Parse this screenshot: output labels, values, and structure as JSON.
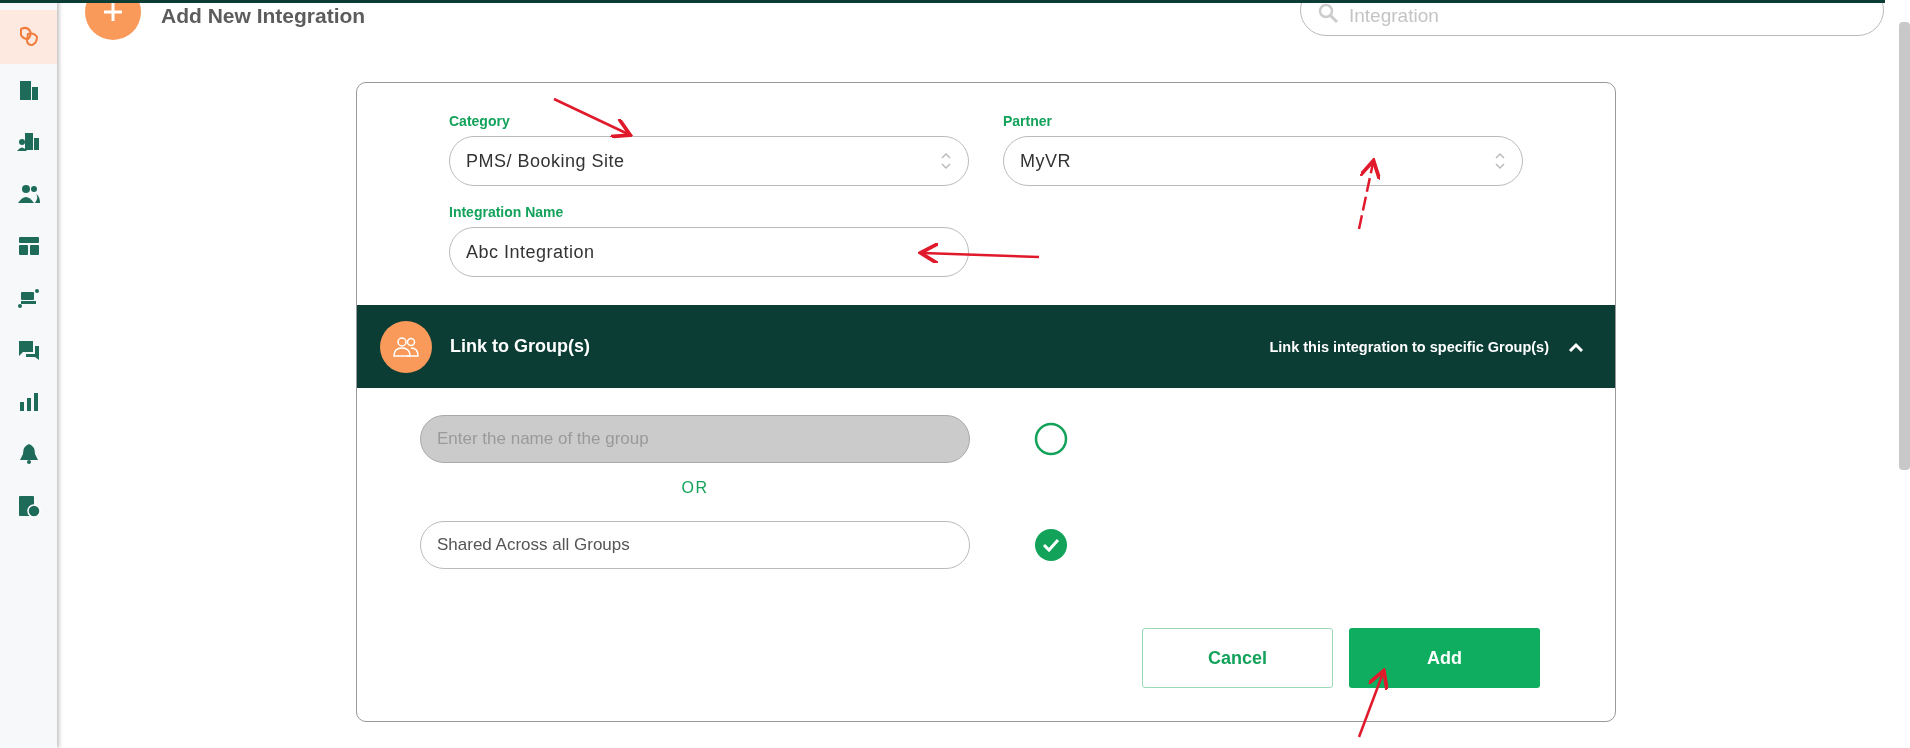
{
  "sidebar": {
    "items": [
      {
        "selected": true
      },
      {
        "selected": false
      },
      {
        "selected": false
      },
      {
        "selected": false
      },
      {
        "selected": false
      },
      {
        "selected": false
      },
      {
        "selected": false
      },
      {
        "selected": false
      },
      {
        "selected": false
      },
      {
        "selected": false
      }
    ]
  },
  "header": {
    "title": "Add New Integration",
    "search": {
      "placeholder": "Integration"
    }
  },
  "form": {
    "fields": [
      {
        "kind": "select",
        "label": "Category",
        "value": "PMS/ Booking Site"
      },
      {
        "kind": "select",
        "label": "Partner",
        "value": "MyVR"
      },
      {
        "kind": "text",
        "label": "Integration Name",
        "value": "Abc Integration"
      }
    ]
  },
  "link_section": {
    "title": "Link to Group(s)",
    "hint": "Link this integration to specific Group(s)",
    "expanded": true,
    "options": [
      {
        "kind": "input",
        "placeholder": "Enter the name of the group",
        "selected": false
      },
      {
        "kind": "value",
        "value": "Shared Across all Groups",
        "selected": true
      }
    ],
    "separator": "OR"
  },
  "buttons": [
    {
      "kind": "secondary",
      "label": "Cancel"
    },
    {
      "kind": "primary",
      "label": "Add"
    }
  ]
}
